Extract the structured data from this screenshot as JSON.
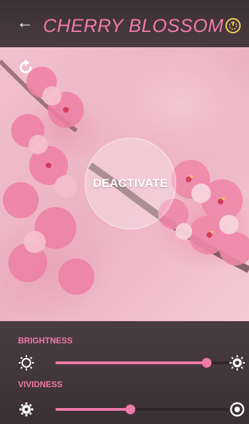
{
  "header": {
    "back_icon": "arrow-left-icon",
    "title": "CHERRY BLOSSOM",
    "power_icon": "power-icon"
  },
  "scene": {
    "reset_icon": "refresh-icon",
    "deactivate_label": "DEACTIVATE"
  },
  "controls": {
    "brightness": {
      "label": "BRIGHTNESS",
      "value_fraction": 0.87,
      "min_icon": "sun-outline-icon",
      "max_icon": "sun-filled-icon"
    },
    "vividness": {
      "label": "VIVIDNESS",
      "value_fraction": 0.43,
      "min_icon": "sun-gear-icon",
      "max_icon": "circle-target-icon"
    }
  },
  "colors": {
    "accent": "#f07aa8",
    "power": "#f3d35b",
    "bar": "#3b3034"
  }
}
